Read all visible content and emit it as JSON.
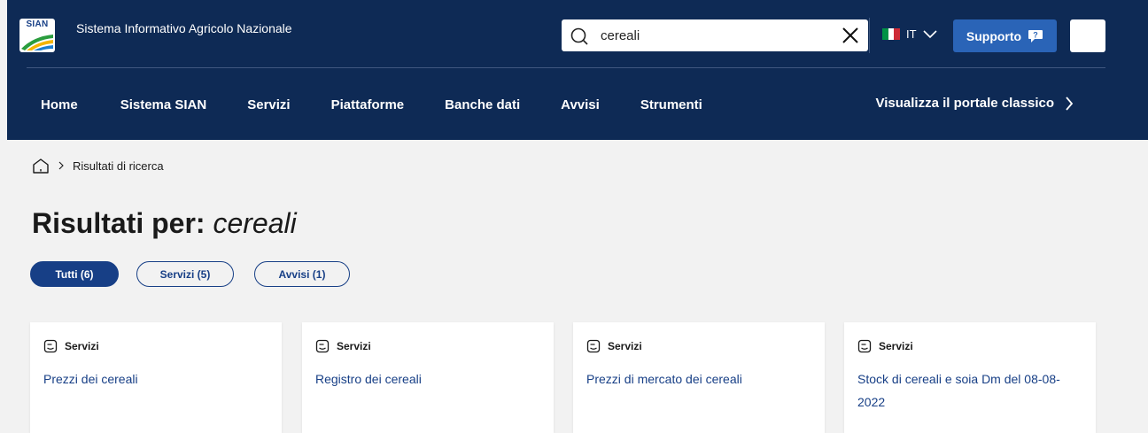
{
  "header": {
    "logo_text": "SIAN",
    "site_name": "Sistema Informativo Agricolo Nazionale",
    "search": {
      "value": "cereali",
      "icon": "search-icon",
      "clear_icon": "close-icon"
    },
    "language": {
      "code": "IT",
      "flag_colors": [
        "#009246",
        "#ffffff",
        "#ce2b37"
      ]
    },
    "support_label": "Supporto",
    "colors": {
      "bar": "#0e2a55",
      "support_button": "#2a64b7"
    }
  },
  "nav": {
    "items": [
      "Home",
      "Sistema SIAN",
      "Servizi",
      "Piattaforme",
      "Banche dati",
      "Avvisi",
      "Strumenti"
    ],
    "classic_label": "Visualizza il portale classico"
  },
  "breadcrumb": {
    "current": "Risultati di ricerca"
  },
  "title": {
    "prefix": "Risultati per:",
    "query": "cereali"
  },
  "filters": [
    {
      "label": "Tutti (6)",
      "active": true
    },
    {
      "label": "Servizi (5)",
      "active": false
    },
    {
      "label": "Avvisi (1)",
      "active": false
    }
  ],
  "results": [
    {
      "type": "Servizi",
      "title": "Prezzi dei cereali"
    },
    {
      "type": "Servizi",
      "title": "Registro dei cereali"
    },
    {
      "type": "Servizi",
      "title": "Prezzi di mercato dei cereali"
    },
    {
      "type": "Servizi",
      "title": "Stock di cereali e soia Dm del 08-08-2022"
    }
  ],
  "accent_color": "#173f86"
}
